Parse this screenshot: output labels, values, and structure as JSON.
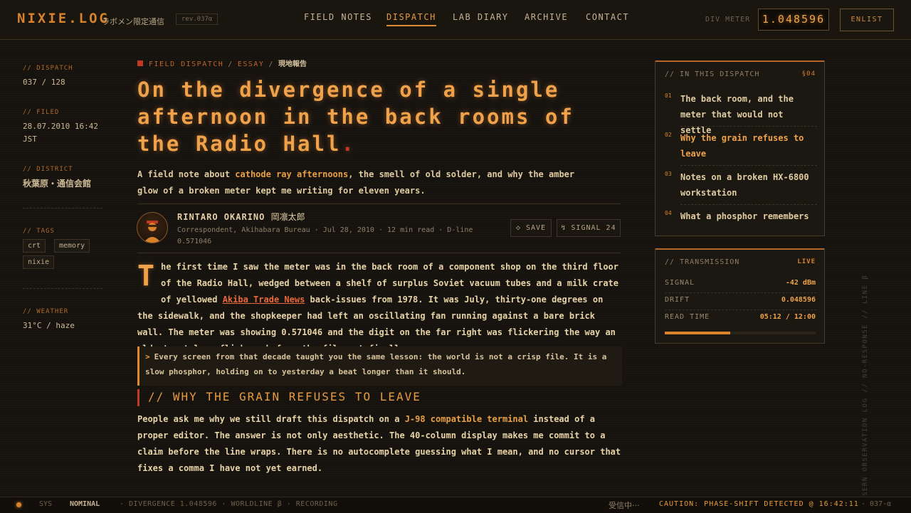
{
  "header": {
    "logo": "NIXIE.LOG",
    "tagline": "ラボメン限定通信",
    "revision": "rev.037α",
    "nav": [
      "FIELD NOTES",
      "DISPATCH",
      "LAB DIARY",
      "ARCHIVE",
      "CONTACT"
    ],
    "active_nav": "DISPATCH",
    "divergence_label": "DIV METER",
    "divergence_value": "1.048596",
    "enlist_label": "ENLIST"
  },
  "meta": {
    "dispatch_label": "// DISPATCH",
    "dispatch_value": "037 / 128",
    "filed_label": "// FILED",
    "filed_value_1": "28.07.2010 16:42",
    "filed_value_2": "JST",
    "district_label": "// DISTRICT",
    "district_value": "秋葉原・通信会館",
    "tags_label": "// TAGS",
    "tags": [
      "crt",
      "memory",
      "nixie"
    ],
    "weather_label": "// WEATHER",
    "weather_value": "31°C / haze"
  },
  "article": {
    "breadcrumb": [
      "FIELD DISPATCH",
      "ESSAY",
      "現地報告"
    ],
    "breadcrumb_sep": "/",
    "title": "On the divergence of a single afternoon in the back rooms of the Radio Hall",
    "title_end": ".",
    "dek_1": "A field note about ",
    "dek_hl": "cathode ray afternoons",
    "dek_2": ", the smell of old solder, and why the amber glow of a broken meter kept me writing for eleven years.",
    "author_name": "RINTARO OKARINO",
    "author_jp": "岡凛太郎",
    "byline": "Correspondent, Akihabara Bureau  ·  Jul 28, 2010  ·  12 min read  ·  D-line 0.571046",
    "save_label": "◇ SAVE",
    "signal_label": "↯ SIGNAL 24",
    "dropcap": "T",
    "p1_a": "he first time I saw the meter was in the back room of a component shop on the third floor of the Radio Hall, wedged between a shelf of surplus Soviet vacuum tubes and a milk crate of yellowed ",
    "p1_link": "Akiba Trade News",
    "p1_b": " back-issues from 1978. It was July, thirty-one degrees on the sidewalk, and the shopkeeper had left an oscillating fan running against a bare brick wall. The meter was showing 0.571046 and the digit on the far right was flickering the way an old street lamp flickers before the filament finally goes.",
    "quote_mark": ">",
    "quote": "Every screen from that decade taught you the same lesson: the world is not a crisp file. It is a slow phosphor, holding on to yesterday a beat longer than it should.",
    "h2": "// WHY THE GRAIN REFUSES TO LEAVE",
    "p2_a": "People ask me why we still draft this dispatch on a ",
    "p2_kw": "J-98 compatible terminal",
    "p2_b": " instead of a proper editor. The answer is not only aesthetic. The 40-column display makes me commit to a claim before the line wraps. There is no autocomplete guessing what I mean, and no cursor that fixes a comma I have not yet earned."
  },
  "toc": {
    "title": "// IN THIS DISPATCH",
    "section": "§04",
    "items": [
      {
        "num": "01",
        "text": "The back room, and the meter that would not settle"
      },
      {
        "num": "02",
        "text": "Why the grain refuses to leave"
      },
      {
        "num": "03",
        "text": "Notes on a broken HX-6800 workstation"
      },
      {
        "num": "04",
        "text": "What a phosphor remembers"
      }
    ]
  },
  "transmission": {
    "title": "// TRANSMISSION",
    "status": "LIVE",
    "signal_label": "SIGNAL",
    "signal_value": "-42 dBm",
    "drift_label": "DRIFT",
    "drift_value": "0.048596",
    "read_label": "READ TIME",
    "read_value": "05:12 / 12:00",
    "read_progress": 0.434
  },
  "side_vertical": "SERN OBSERVATION LOG // NO-RESPONSE // LINE β",
  "footer": {
    "sys": "SYS",
    "status": "NOMINAL",
    "info": "· DIVERGENCE 1.048596 · WORLDLINE β · RECORDING",
    "receiving": "受信中···",
    "caution": "CAUTION: PHASE-SHIFT DETECTED @ 16:42:11",
    "code": "· 037-α"
  },
  "colors": {
    "accent": "#e89a3c",
    "alert": "#c23a22",
    "background": "#16130f"
  }
}
